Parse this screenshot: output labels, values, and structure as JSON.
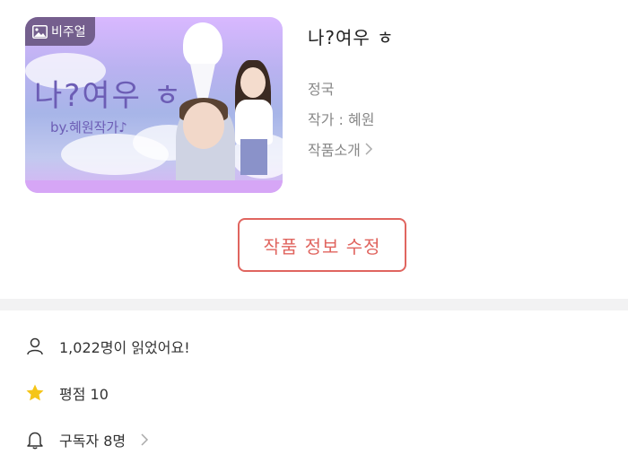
{
  "work": {
    "title": "나?여우 ㅎ",
    "badge_label": "비주얼",
    "cover_title": "나?여우 ㅎ",
    "cover_author": "by.혜원작가♪",
    "character": "정국",
    "author_line": "작가 : 혜원",
    "intro_link": "작품소개"
  },
  "actions": {
    "edit_label": "작품 정보 수정"
  },
  "stats": {
    "reads": "1,022명이 읽었어요!",
    "rating": "평점 10",
    "subscribers": "구독자 8명"
  },
  "colors": {
    "accent": "#e0655f",
    "star": "#f5c518",
    "divider": "#f2f2f3"
  },
  "icons": {
    "badge": "image-icon",
    "reads": "person-icon",
    "rating": "star-icon",
    "subscribers": "bell-icon",
    "chevron": "chevron-right-icon"
  }
}
